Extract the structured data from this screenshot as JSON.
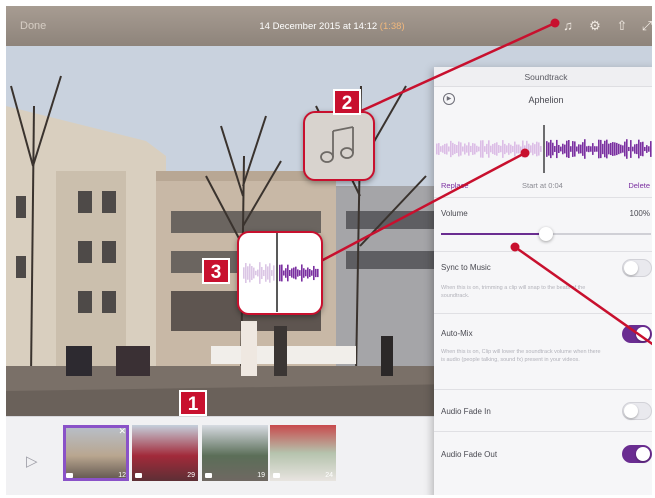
{
  "topbar": {
    "back_label": "Done",
    "title": "14 December 2015 at 14:12",
    "count": "(1:38)",
    "icons": [
      "music-note-icon",
      "gear-icon",
      "share-icon",
      "expand-icon"
    ]
  },
  "soundtrack": {
    "header": "Soundtrack",
    "track_name": "Aphelion",
    "replace_label": "Replace",
    "start_label": "Start at 0:04",
    "delete_label": "Delete",
    "volume_label": "Volume",
    "volume_value": "100%",
    "volume_level": 0.5,
    "sync_label": "Sync to Music",
    "sync_desc": "When this is on, trimming a clip will snap to the beats of the soundtrack.",
    "sync_on": false,
    "automix_label": "Auto-Mix",
    "automix_desc": "When this is on, Clip will lower the soundtrack volume when there is audio (people talking, sound fx) present in your videos.",
    "automix_on": true,
    "fadein_label": "Audio Fade In",
    "fadein_on": false,
    "fadeout_label": "Audio Fade Out",
    "fadeout_on": true
  },
  "filmstrip": {
    "clips": [
      {
        "duration": "12",
        "selected": true
      },
      {
        "duration": "29",
        "selected": false
      },
      {
        "duration": "19",
        "selected": false
      },
      {
        "duration": "24",
        "selected": false
      }
    ]
  },
  "callouts": {
    "one": "1",
    "two": "2",
    "three": "3"
  },
  "colors": {
    "accent": "#6a2d91",
    "callout": "#c8102e",
    "count": "#f0b77d"
  }
}
